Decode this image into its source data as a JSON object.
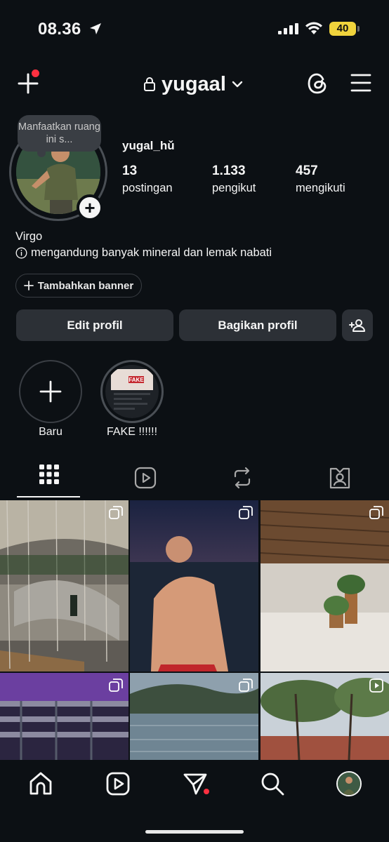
{
  "status_bar": {
    "time": "08.36",
    "battery": "40"
  },
  "header": {
    "username": "yugaal"
  },
  "profile": {
    "note": "Manfaatkan ruang ini s...",
    "handle": "yugal_hǔ",
    "stats": [
      {
        "value": "13",
        "label": "postingan"
      },
      {
        "value": "1.133",
        "label": "pengikut"
      },
      {
        "value": "457",
        "label": "mengikuti"
      }
    ],
    "bio_name": "Virgo",
    "bio_text": "mengandung banyak mineral dan lemak nabati",
    "banner_button": "Tambahkan banner",
    "edit_button": "Edit profil",
    "share_button": "Bagikan profil"
  },
  "highlights": [
    {
      "label": "Baru"
    },
    {
      "label": "FAKE !!!!!!",
      "thumb_text": "FAKE"
    }
  ],
  "tabs": [
    "grid",
    "reels",
    "reposts",
    "tagged"
  ],
  "grid": {
    "tiles": [
      {
        "type": "carousel",
        "scene": "mall-staircase"
      },
      {
        "type": "carousel",
        "scene": "beach-night-portrait"
      },
      {
        "type": "carousel",
        "scene": "wooden-ceiling-room"
      },
      {
        "type": "carousel",
        "scene": "stadium-purple"
      },
      {
        "type": "carousel",
        "scene": "lake-mountains"
      },
      {
        "type": "reel",
        "scene": "trees-park"
      }
    ]
  },
  "nav": [
    "home",
    "reels",
    "direct",
    "search",
    "profile"
  ],
  "colors": {
    "background": "#0c1014",
    "button": "#2c3036",
    "notification": "#ff3040",
    "battery": "#f0d33c"
  }
}
